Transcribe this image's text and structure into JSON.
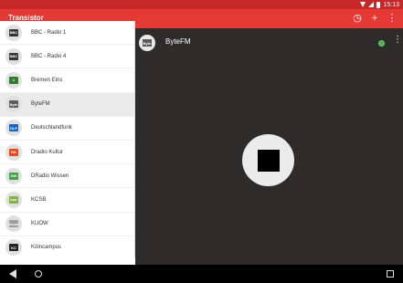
{
  "statusbar": {
    "time": "15:13",
    "icons": [
      "wifi-icon",
      "signal-icon",
      "battery-icon"
    ]
  },
  "appbar": {
    "title": "Transistor",
    "actions": [
      {
        "name": "timer-icon",
        "glyph": "◷"
      },
      {
        "name": "add-icon",
        "glyph": "+"
      },
      {
        "name": "overflow-menu-icon",
        "glyph": "⋮"
      }
    ]
  },
  "stations": [
    {
      "name": "BBC - Radio 1",
      "logo_text": "BBC",
      "logo_color": "#333333"
    },
    {
      "name": "BBC - Radio 4",
      "logo_text": "BBC",
      "logo_color": "#333333"
    },
    {
      "name": "Bremen Eins",
      "logo_text": "1",
      "logo_color": "#2e7d32"
    },
    {
      "name": "ByteFM",
      "logo_text": "Byte",
      "logo_color": "#5a5a5a",
      "selected": true
    },
    {
      "name": "Deutschlandfunk",
      "logo_text": "DLF",
      "logo_color": "#1565c0"
    },
    {
      "name": "Dradio Kultur",
      "logo_text": "DK",
      "logo_color": "#e64a19"
    },
    {
      "name": "DRadio Wissen",
      "logo_text": "DW",
      "logo_color": "#43a047"
    },
    {
      "name": "KCSB",
      "logo_text": "ksb",
      "logo_color": "#7cb342"
    },
    {
      "name": "KUOW",
      "logo_text": "kuow",
      "logo_color": "#9e9e9e"
    },
    {
      "name": "Kölncampus",
      "logo_text": "KC",
      "logo_color": "#212121"
    }
  ],
  "player": {
    "station_name": "ByteFM",
    "logo_text": "Byte",
    "status_color": "#4caf50",
    "menu_glyph": "⋮"
  },
  "navbar": {
    "buttons": [
      "back-button",
      "home-button",
      "recents-button"
    ]
  }
}
